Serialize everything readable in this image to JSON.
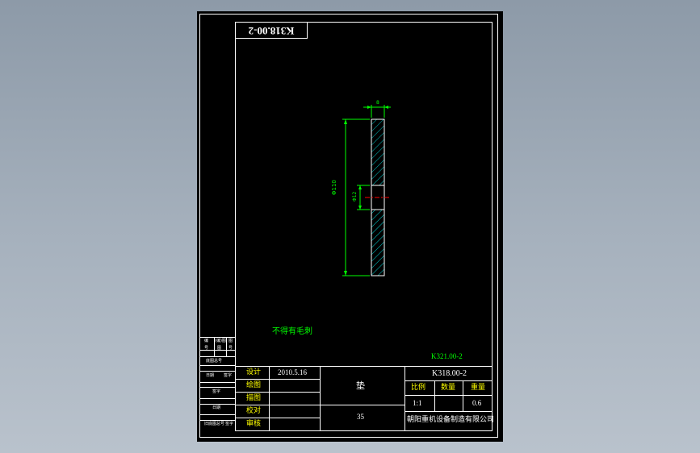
{
  "colors": {
    "background": "#9aa6b3",
    "paper": "#000000",
    "frame": "#ffffff",
    "green": "#00ff00",
    "yellow": "#ffff00",
    "red": "#ff0000",
    "hatch": "#00c8c8"
  },
  "drawing": {
    "rotated_code": "K318.00-2",
    "dims": {
      "thickness": "8",
      "outer": "Φ110",
      "hole": "Φ12"
    },
    "note": "不得有毛刺",
    "ref_code": "K321.00-2"
  },
  "side_table": {
    "rows": [
      [
        "编",
        "(编)图",
        "图"
      ],
      [
        "号",
        "图",
        "号"
      ],
      [
        "",
        "底图总号",
        ""
      ],
      [
        "",
        "日期",
        "签字"
      ],
      [
        "",
        "签字",
        ""
      ],
      [
        "",
        "日期",
        ""
      ],
      [
        "",
        "旧底图总号",
        "签字"
      ]
    ]
  },
  "title_block": {
    "labels": [
      "设计",
      "绘图",
      "描图",
      "校对",
      "审核"
    ],
    "date": "2010.5.16",
    "part_name": "垫",
    "material": "35",
    "drawing_no": "K318.00-2",
    "headers": [
      "比例",
      "数量",
      "重量"
    ],
    "values": [
      "1:1",
      "",
      "0.6"
    ],
    "company": "朝阳重机设备制造有限公司"
  }
}
